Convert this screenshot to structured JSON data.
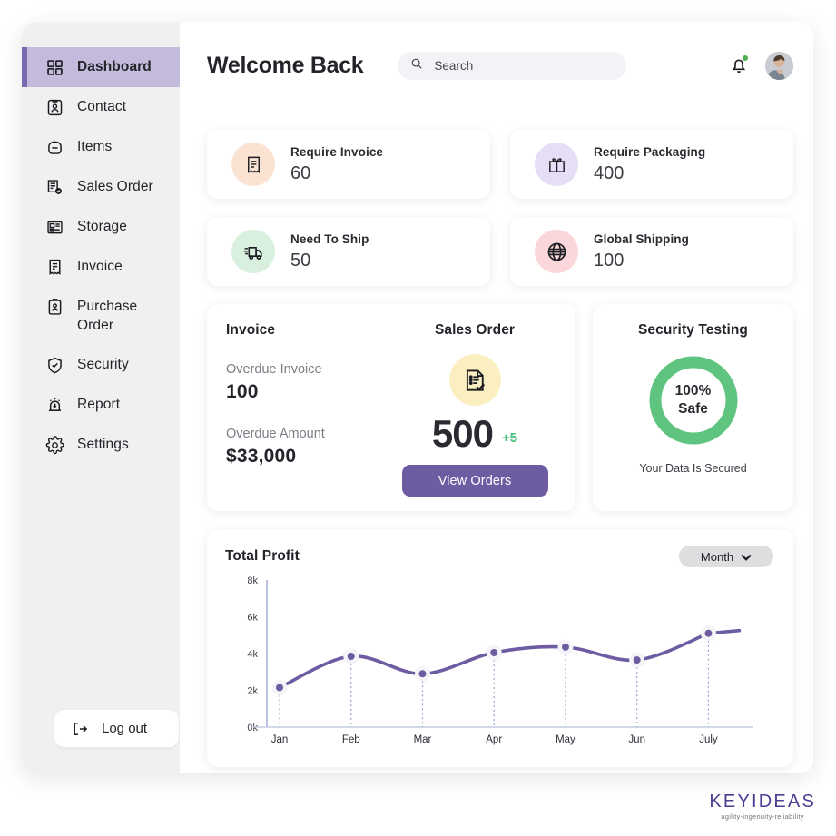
{
  "sidebar": {
    "items": [
      {
        "label": "Dashboard",
        "icon": "grid-icon",
        "active": true
      },
      {
        "label": "Contact",
        "icon": "contact-card-icon",
        "active": false
      },
      {
        "label": "Items",
        "icon": "bag-icon",
        "active": false
      },
      {
        "label": "Sales Order",
        "icon": "order-check-icon",
        "active": false
      },
      {
        "label": "Storage",
        "icon": "storage-icon",
        "active": false
      },
      {
        "label": "Invoice",
        "icon": "invoice-icon",
        "active": false
      },
      {
        "label": "Purchase Order",
        "icon": "clipboard-person-icon",
        "active": false
      },
      {
        "label": "Security",
        "icon": "shield-check-icon",
        "active": false
      },
      {
        "label": "Report",
        "icon": "alarm-report-icon",
        "active": false
      },
      {
        "label": "Settings",
        "icon": "gear-icon",
        "active": false
      }
    ],
    "logout_label": "Log out",
    "active_bg": "#c4bbdc",
    "active_bar": "#7a6bb0"
  },
  "topbar": {
    "title": "Welcome Back",
    "search_placeholder": "Search",
    "search_value": "",
    "notification_badge_color": "#4caf50"
  },
  "stats": [
    {
      "label": "Require Invoice",
      "value": "60",
      "icon": "receipt-icon",
      "bg": "#fbe3d3"
    },
    {
      "label": "Require Packaging",
      "value": "400",
      "icon": "gift-box-icon",
      "bg": "#e6ddf7"
    },
    {
      "label": "Need To Ship",
      "value": "50",
      "icon": "truck-icon",
      "bg": "#d9f0de"
    },
    {
      "label": "Global Shipping",
      "value": "100",
      "icon": "globe-icon",
      "bg": "#fbd6da"
    }
  ],
  "invoice": {
    "title": "Invoice",
    "overdue_invoice_label": "Overdue Invoice",
    "overdue_invoice_value": "100",
    "overdue_amount_label": "Overdue Amount",
    "overdue_amount_value": "$33,000"
  },
  "sales_order": {
    "title": "Sales Order",
    "icon": "document-check-icon",
    "icon_bg": "#fbeec0",
    "value": "500",
    "delta": "+5",
    "delta_color": "#45c27f",
    "button_label": "View Orders",
    "button_color": "#6e5ca3"
  },
  "security": {
    "title": "Security Testing",
    "gauge_line1": "100%",
    "gauge_line2": "Safe",
    "gauge_percent": 100,
    "gauge_color": "#5ec47f",
    "caption": "Your Data Is Secured"
  },
  "chart_data": {
    "type": "line",
    "title": "Total Profit",
    "period_label": "Month",
    "categories": [
      "Jan",
      "Feb",
      "Mar",
      "Apr",
      "May",
      "Jun",
      "July"
    ],
    "values": [
      2150,
      3850,
      2900,
      4050,
      4350,
      3650,
      5100
    ],
    "yticks": [
      0,
      2000,
      4000,
      6000,
      8000
    ],
    "ytick_labels": [
      "0k",
      "2k",
      "4k",
      "6k",
      "8k"
    ],
    "ylim": [
      0,
      8000
    ],
    "xlabel": "",
    "ylabel": "",
    "grid": false,
    "legend": "none",
    "line_color": "#6e5ca3",
    "marker_color": "#6e5ca3"
  },
  "brand": {
    "name": "KEYIDEAS",
    "tagline": "agility-ingenuity-reliability"
  }
}
